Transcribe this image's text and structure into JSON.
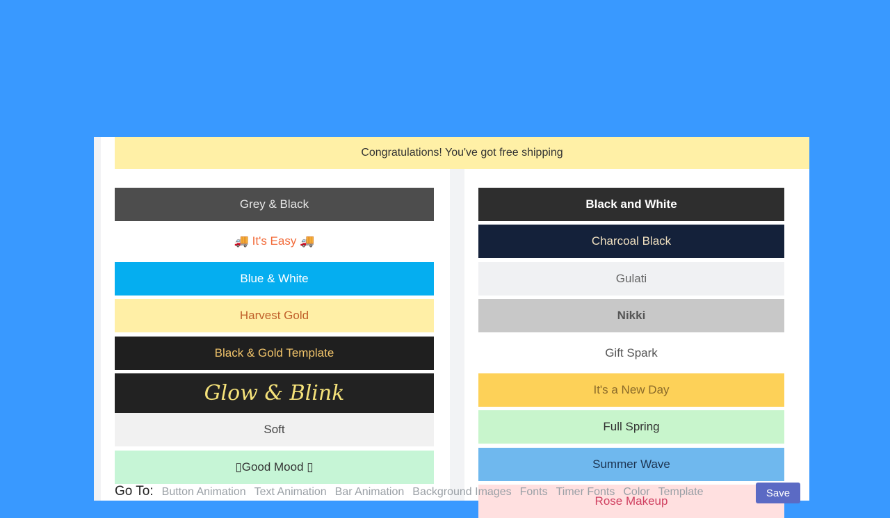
{
  "banner": {
    "text": "Congratulations! You've got free shipping"
  },
  "left_templates": [
    {
      "label": "Grey & Black",
      "bg": "#4d4d4d",
      "fg": "#e8e8e8"
    },
    {
      "label": "🚚 It's Easy 🚚",
      "bg": "#ffffff",
      "fg": "#f26b3a"
    },
    {
      "label": "Blue & White",
      "bg": "#05aef0",
      "fg": "#ffffff"
    },
    {
      "label": "Harvest Gold",
      "bg": "#ffefa6",
      "fg": "#c0602a"
    },
    {
      "label": "Black & Gold Template",
      "bg": "#1f1f1f",
      "fg": "#f0c36a"
    },
    {
      "label": "Glow & Blink",
      "bg": "#222222",
      "fg": "#f5e27a"
    },
    {
      "label": "Soft",
      "bg": "#f1f1f1",
      "fg": "#444444"
    },
    {
      "label": "▯Good Mood ▯",
      "bg": "#c6f5d6",
      "fg": "#333333"
    }
  ],
  "right_templates": [
    {
      "label": "Black and White",
      "bg": "#2e2e2e",
      "fg": "#ffffff"
    },
    {
      "label": "Charcoal Black",
      "bg": "#14213a",
      "fg": "#f0e0c0"
    },
    {
      "label": "Gulati",
      "bg": "#f0f1f3",
      "fg": "#666666"
    },
    {
      "label": "Nikki",
      "bg": "#c8c8c8",
      "fg": "#555555"
    },
    {
      "label": "Gift Spark",
      "bg": "#ffffff",
      "fg": "#555555"
    },
    {
      "label": "It's a New Day",
      "bg": "#fdd158",
      "fg": "#8a6a2a"
    },
    {
      "label": "Full Spring",
      "bg": "#c8f5cc",
      "fg": "#333333"
    },
    {
      "label": "Summer Wave",
      "bg": "#6fb8ee",
      "fg": "#1c3350"
    },
    {
      "label": "Rose Makeup",
      "bg": "#ffe0e0",
      "fg": "#d04060"
    }
  ],
  "nav": {
    "label": "Go To:",
    "links": [
      "Button Animation",
      "Text Animation",
      "Bar Animation",
      "Background Images",
      "Fonts",
      "Timer Fonts",
      "Color",
      "Template"
    ]
  },
  "save_label": "Save"
}
